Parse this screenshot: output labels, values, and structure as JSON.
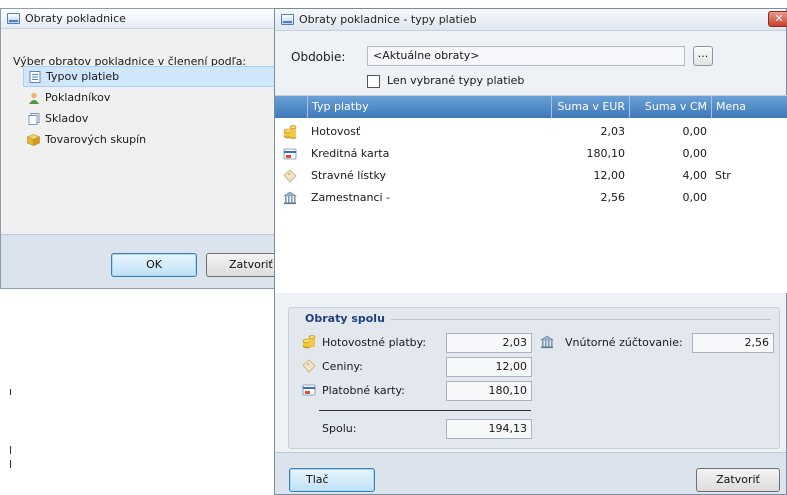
{
  "dialog_left": {
    "title": "Obraty pokladnice",
    "prompt": "Výber obratov pokladnice v členení podľa:",
    "items": [
      {
        "label": "Typov platieb",
        "icon": "list-icon",
        "selected": true
      },
      {
        "label": "Pokladníkov",
        "icon": "user-icon",
        "selected": false
      },
      {
        "label": "Skladov",
        "icon": "document-icon",
        "selected": false
      },
      {
        "label": "Tovarových skupín",
        "icon": "box-icon",
        "selected": false
      }
    ],
    "ok_label": "OK",
    "close_label": "Zatvoriť"
  },
  "dialog_main": {
    "title": "Obraty pokladnice - typy platieb",
    "close_symbol": "✕",
    "period_label": "Obdobie:",
    "period_value": "<Aktuálne obraty>",
    "dots_label": "...",
    "checkbox_label": "Len vybrané typy platieb",
    "columns": [
      "Typ platby",
      "Suma v EUR",
      "Suma v CM",
      "Mena"
    ],
    "rows": [
      {
        "icon": "coins-icon",
        "type": "Hotovosť",
        "eur": "2,03",
        "cm": "0,00",
        "currency": ""
      },
      {
        "icon": "credit-card-icon",
        "type": "Kreditná karta",
        "eur": "180,10",
        "cm": "0,00",
        "currency": ""
      },
      {
        "icon": "ticket-icon",
        "type": "Stravné lístky",
        "eur": "12,00",
        "cm": "4,00",
        "currency": "Str"
      },
      {
        "icon": "bank-icon",
        "type": "Zamestnanci -",
        "eur": "2,56",
        "cm": "0,00",
        "currency": ""
      }
    ],
    "summary": {
      "title": "Obraty spolu",
      "cash_label": "Hotovostné platby:",
      "cash_value": "2,03",
      "internal_label": "Vnútorné zúčtovanie:",
      "internal_value": "2,56",
      "vouchers_label": "Ceniny:",
      "vouchers_value": "12,00",
      "cards_label": "Platobné karty:",
      "cards_value": "180,10",
      "total_label": "Spolu:",
      "total_value": "194,13"
    },
    "print_label": "Tlač",
    "close_label": "Zatvoriť"
  }
}
